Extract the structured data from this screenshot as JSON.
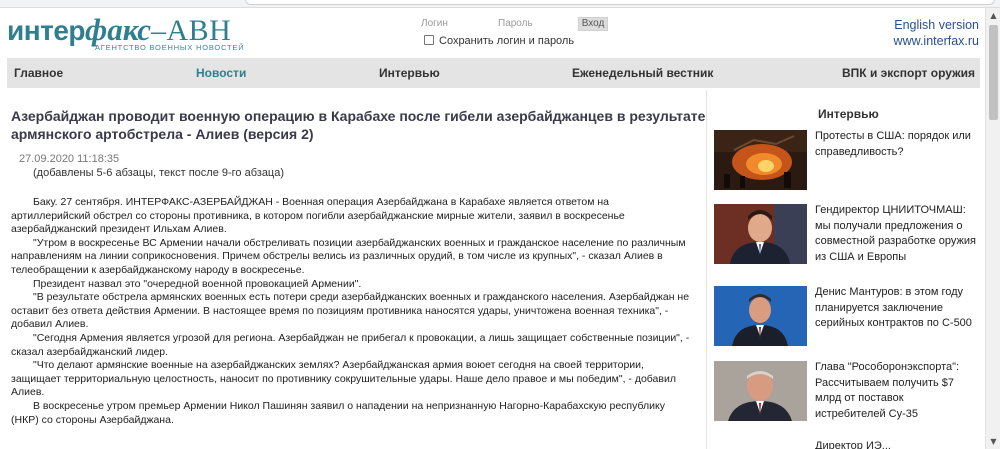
{
  "header": {
    "logo_main_a": "интер",
    "logo_main_b": "факс",
    "logo_main_c": "–АВН",
    "logo_sub": "агентство военных новостей",
    "login_placeholder": "Логин",
    "password_placeholder": "Пароль",
    "login_button": "Вход",
    "remember_label": "Сохранить логин и пароль",
    "english_link": "English version",
    "site_link": "www.interfax.ru"
  },
  "nav": {
    "items": [
      {
        "label": "Главное"
      },
      {
        "label": "Новости"
      },
      {
        "label": "Интервью"
      },
      {
        "label": "Еженедельный вестник"
      },
      {
        "label": "ВПК и экспорт оружия"
      }
    ]
  },
  "article": {
    "title": "Азербайджан проводит военную операцию в Карабахе после гибели азербайджанцев в результате армянского артобстрела - Алиев (версия 2)",
    "date": "27.09.2020 11:18:35",
    "note": "(добавлены 5-6 абзацы, текст после 9-го абзаца)",
    "paragraphs": [
      "Баку. 27 сентября. ИНТЕРФАКС-АЗЕРБАЙДЖАН - Военная операция Азербайджана в Карабахе является ответом на артиллерийский обстрел со стороны противника, в котором погибли азербайджанские мирные жители, заявил в воскресенье азербайджанский президент Ильхам Алиев.",
      "\"Утром в воскресенье ВС Армении начали обстреливать позиции азербайджанских военных и гражданское население по различным направлениям на линии соприкосновения. Причем обстрелы велись из различных орудий, в том числе из крупных\", - сказал Алиев в телеобращении к азербайджанскому народу в воскресенье.",
      "Президент назвал это \"очередной военной провокацией Армении\".",
      "\"В результате обстрела армянских военных есть потери среди азербайджанских военных и гражданского населения. Азербайджан не оставит без ответа действия Армении. В настоящее время по позициям противника наносятся удары, уничтожена военная техника\", - добавил Алиев.",
      "\"Сегодня Армения является угрозой для региона. Азербайджан не прибегал к провокации, а лишь защищает собственные позиции\", - сказал азербайджанский лидер.",
      "\"Что делают армянские военные на азербайджанских землях? Азербайджанская армия воюет сегодня на своей территории, защищает территориальную целостность, наносит по противнику сокрушительные удары. Наше дело правое и мы победим\", - добавил Алиев.",
      "В воскресенье утром премьер Армении Никол Пашинян заявил о нападении на непризнанную Нагорно-Карабахскую республику (НКР) со стороны Азербайджана."
    ]
  },
  "sidebar": {
    "title": "Интервью",
    "items": [
      {
        "text": "Протесты в США: порядок или справедливость?"
      },
      {
        "text": "Гендиректор ЦНИИТОЧМАШ: мы получали предложения о совместной разработке оружия из США и Европы"
      },
      {
        "text": "Денис Мантуров: в этом году планируется заключение серийных контрактов по С-500"
      },
      {
        "text": "Глава \"Рособоронэкспорта\": Рассчитываем получить $7 млрд от поставок истребителей Су-35"
      },
      {
        "text": "Директор ИЭ..."
      }
    ]
  },
  "colors": {
    "brand": "#2f7f8e",
    "nav_bg": "#e4e4e4",
    "link": "#2a4f8f"
  }
}
